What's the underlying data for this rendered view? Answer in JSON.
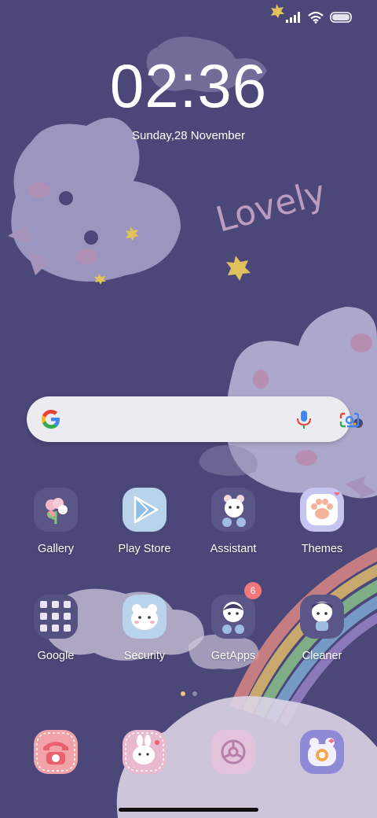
{
  "clock": {
    "time": "02:36",
    "date": "Sunday,28 November"
  },
  "wallpaper": {
    "caption": "Lovely"
  },
  "search": {
    "provider_icon": "google-g-icon"
  },
  "apps": {
    "gallery": {
      "label": "Gallery"
    },
    "play_store": {
      "label": "Play Store"
    },
    "assistant": {
      "label": "Assistant"
    },
    "themes": {
      "label": "Themes"
    },
    "google": {
      "label": "Google"
    },
    "security": {
      "label": "Security"
    },
    "getapps": {
      "label": "GetApps",
      "badge": "6"
    },
    "cleaner": {
      "label": "Cleaner"
    }
  },
  "pager": {
    "pages": 2,
    "current": 1
  },
  "colors": {
    "background": "#4b4779",
    "accent_dot": "#f4c27a",
    "badge": "#f2777a",
    "search_bar": "#ecebf0"
  }
}
